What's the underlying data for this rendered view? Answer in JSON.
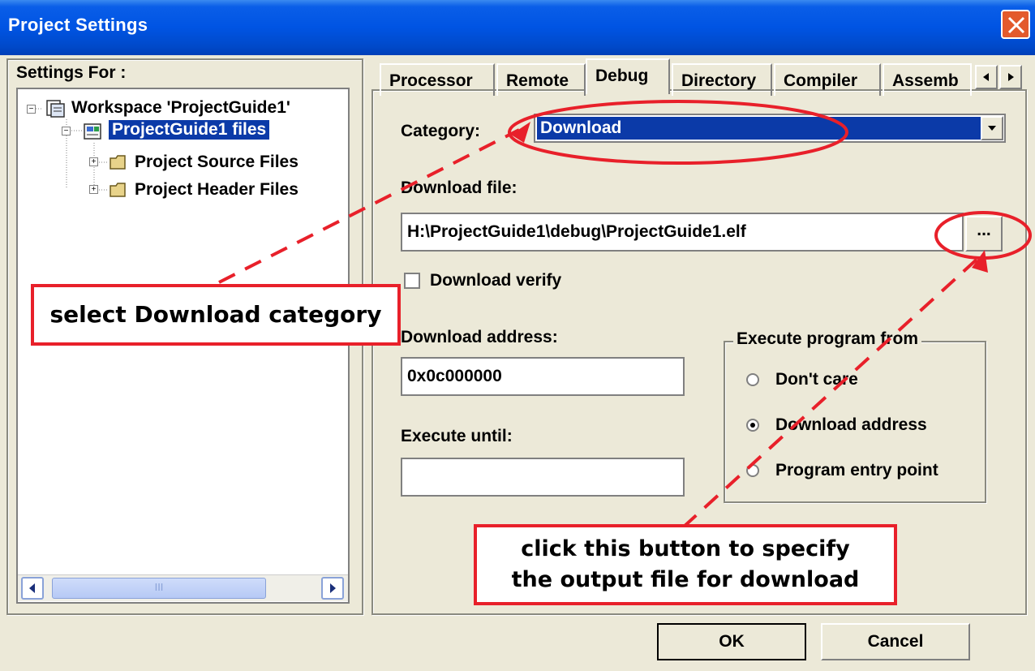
{
  "window": {
    "title": "Project Settings"
  },
  "settings_for": {
    "label": "Settings For :",
    "tree": [
      {
        "label": "Workspace 'ProjectGuide1'",
        "icon": "workspace-icon",
        "selected": false
      },
      {
        "label": "ProjectGuide1 files",
        "icon": "project-icon",
        "selected": true
      },
      {
        "label": "Project Source Files",
        "icon": "folder-icon",
        "selected": false
      },
      {
        "label": "Project Header Files",
        "icon": "folder-icon",
        "selected": false
      }
    ],
    "scrollbar_grip": "III"
  },
  "tabs": [
    {
      "label": "Processor",
      "active": false
    },
    {
      "label": "Remote",
      "active": false
    },
    {
      "label": "Debug",
      "active": true
    },
    {
      "label": "Directory",
      "active": false
    },
    {
      "label": "Compiler",
      "active": false
    },
    {
      "label": "Assemb",
      "active": false
    }
  ],
  "debug": {
    "category_label": "Category:",
    "category_value": "Download",
    "download_file_label": "Download file:",
    "download_file_value": "H:\\ProjectGuide1\\debug\\ProjectGuide1.elf",
    "browse_label": "...",
    "download_verify_label": "Download verify",
    "download_verify_checked": false,
    "download_address_label": "Download address:",
    "download_address_value": "0x0c000000",
    "execute_until_label": "Execute until:",
    "execute_until_value": "",
    "execute_from": {
      "title": "Execute program from",
      "options": [
        {
          "label": "Don't care",
          "selected": false
        },
        {
          "label": "Download address",
          "selected": true
        },
        {
          "label": "Program entry point",
          "selected": false
        }
      ]
    }
  },
  "buttons": {
    "ok": "OK",
    "cancel": "Cancel"
  },
  "annotations": {
    "callout_category": "select Download category",
    "callout_button_line1": "click this button to specify",
    "callout_button_line2": "the output file for download"
  },
  "colors": {
    "annotation_red": "#e8202a",
    "selection_blue": "#0b3aa8",
    "title_blue": "#0054e3"
  }
}
